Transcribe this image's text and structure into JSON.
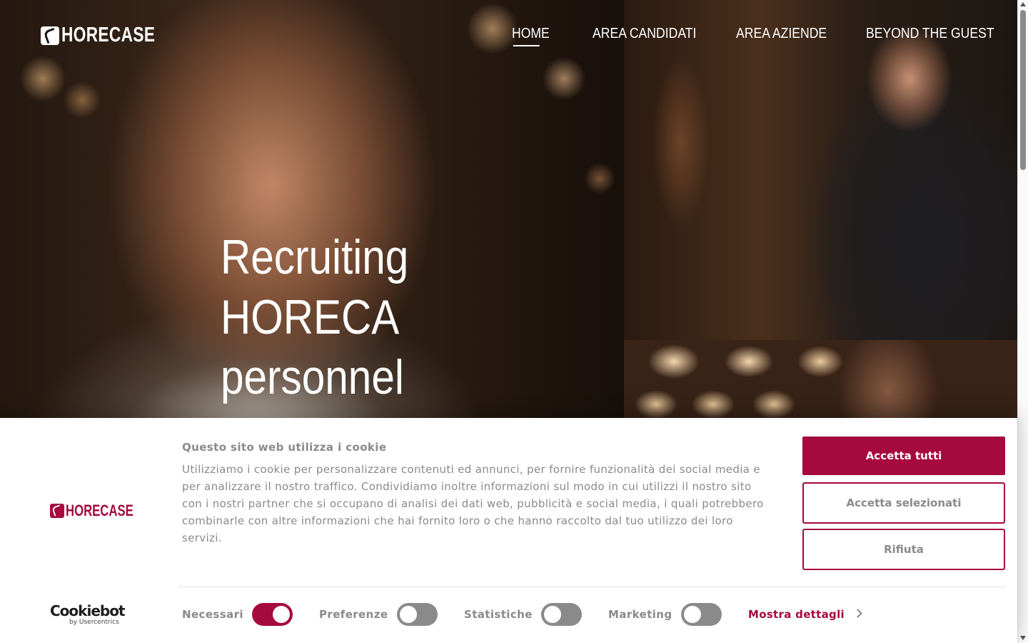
{
  "site": {
    "logo_text": "HORECASE",
    "nav": [
      {
        "label": "HOME",
        "active": true
      },
      {
        "label": "AREA CANDIDATI",
        "active": false
      },
      {
        "label": "AREA AZIENDE",
        "active": false
      },
      {
        "label": "BEYOND THE GUEST",
        "active": false
      }
    ],
    "hero": {
      "headline_lines": [
        "Recruiting",
        "HORECA",
        "personnel",
        "&"
      ]
    }
  },
  "cookie_banner": {
    "logo_text": "HORECASE",
    "title": "Questo sito web utilizza i cookie",
    "body": "Utilizziamo i cookie per personalizzare contenuti ed annunci, per fornire funzionalità dei social media e per analizzare il nostro traffico. Condividiamo inoltre informazioni sul modo in cui utilizzi il nostro sito con i nostri partner che si occupano di analisi dei dati web, pubblicità e social media, i quali potrebbero combinarle con altre informazioni che hai fornito loro o che hanno raccolto dal tuo utilizzo dei loro servizi.",
    "buttons": {
      "accept_all": "Accetta tutti",
      "accept_selected": "Accetta selezionati",
      "reject": "Rifiuta"
    },
    "toggles": [
      {
        "label": "Necessari",
        "on": true
      },
      {
        "label": "Preferenze",
        "on": false
      },
      {
        "label": "Statistiche",
        "on": false
      },
      {
        "label": "Marketing",
        "on": false
      }
    ],
    "show_details": "Mostra dettagli",
    "cookiebot": {
      "name": "Cookiebot",
      "by": "by Usercentrics"
    }
  },
  "colors": {
    "brand": "#a6093d",
    "muted_text": "#8a8a8a",
    "toggle_off": "#8a8a8a"
  }
}
